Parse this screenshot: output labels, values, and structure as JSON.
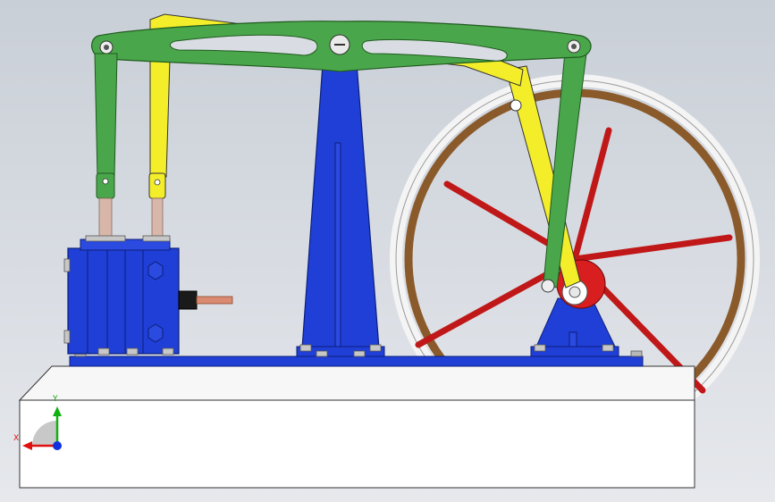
{
  "viewport": {
    "triad": {
      "x_label": "X",
      "y_label": "Y"
    }
  },
  "colors": {
    "background_top": "#c9cfd7",
    "base_block": "#ffffff",
    "frame_blue": "#1f3fd6",
    "beam_green": "#4aa64a",
    "link_yellow": "#f4ee2a",
    "flywheel_rim": "#8a5a2b",
    "flywheel_spoke": "#c01818",
    "crank_red": "#d81e1e",
    "piston_rod": "#d98a70",
    "axis_x": "#e01010",
    "axis_y": "#10b010",
    "axis_z": "#1030e0"
  },
  "parts": [
    "base-block",
    "base-plate",
    "cylinder-block",
    "center-column",
    "walking-beam",
    "parallel-link",
    "connecting-rod",
    "flywheel",
    "crank-bearing",
    "crank"
  ]
}
